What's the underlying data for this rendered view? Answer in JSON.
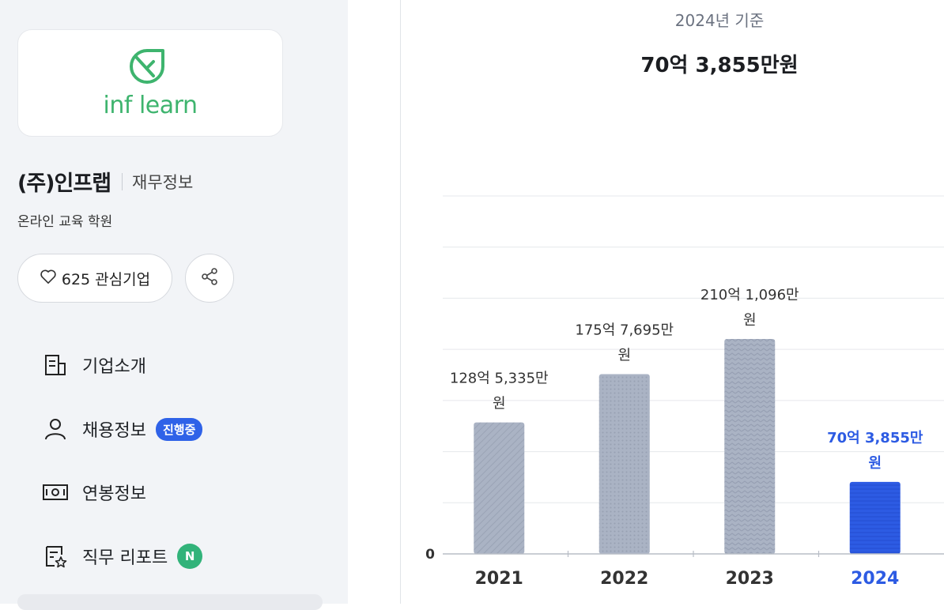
{
  "sidebar": {
    "logo_text": "inf learn",
    "company_name": "(주)인프랩",
    "company_section": "재무정보",
    "industry": "온라인 교육 학원",
    "favorite_label": "625 관심기업",
    "nav": [
      {
        "label": "기업소개",
        "icon": "building-doc-icon"
      },
      {
        "label": "채용정보",
        "icon": "person-icon",
        "badge": "진행중"
      },
      {
        "label": "연봉정보",
        "icon": "money-icon"
      },
      {
        "label": "직무 리포트",
        "icon": "report-star-icon",
        "badge": "N"
      }
    ]
  },
  "main": {
    "basis": "2024년 기준",
    "headline": "70억 3,855만원"
  },
  "colors": {
    "bar_gray": "#aab3c4",
    "bar_highlight": "#2d5be3",
    "label_highlight": "#2d5be3",
    "accent_green": "#3eb46e"
  },
  "chart_data": {
    "type": "bar",
    "categories": [
      "2021",
      "2022",
      "2023",
      "2024"
    ],
    "values": [
      128.5335,
      175.7695,
      210.1096,
      70.3855
    ],
    "value_labels": [
      [
        "128억 5,335만",
        "원"
      ],
      [
        "175억 7,695만",
        "원"
      ],
      [
        "210억 1,096만",
        "원"
      ],
      [
        "70억 3,855만",
        "원"
      ]
    ],
    "highlight_index": 3,
    "y_min_label": "0",
    "ylim": [
      0,
      350
    ],
    "grid": true
  }
}
